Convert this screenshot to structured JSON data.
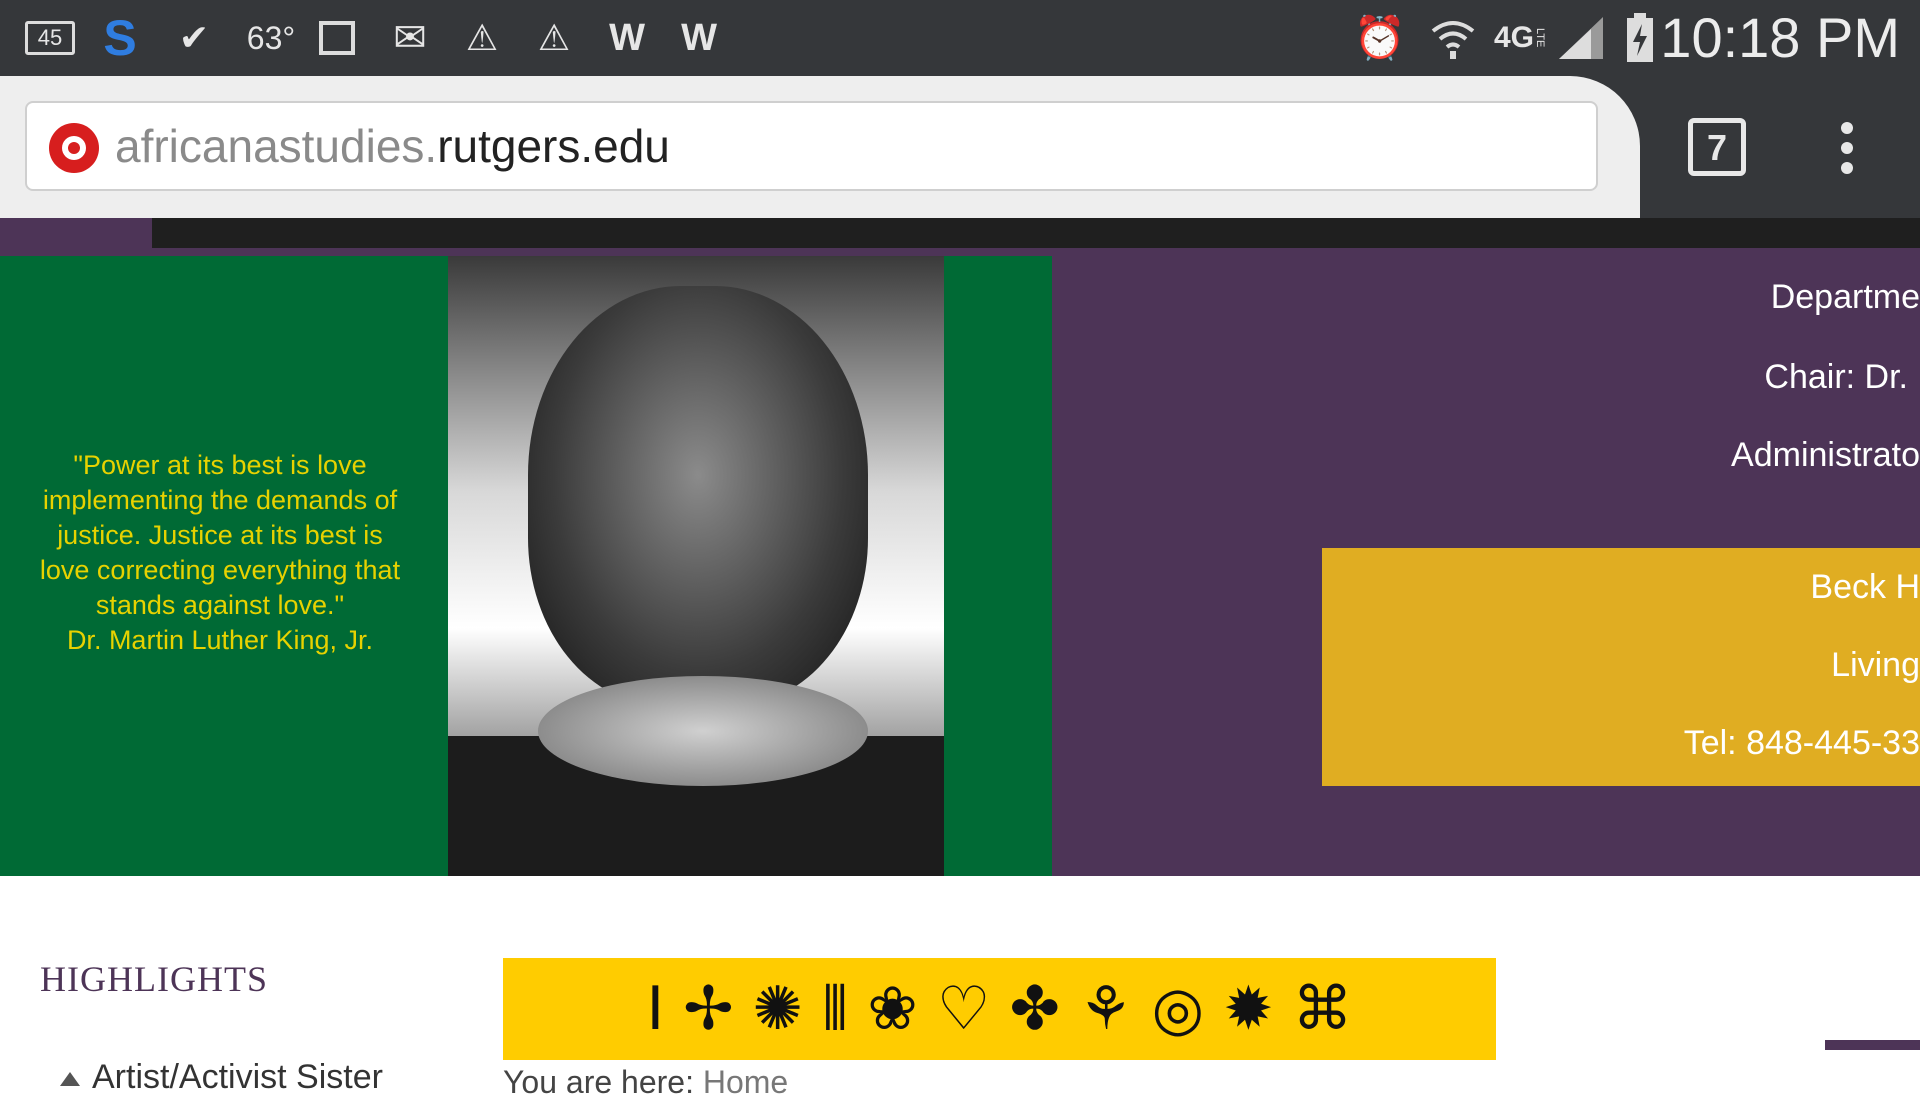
{
  "status_bar": {
    "battery_level": "45",
    "temperature": "63°",
    "network": "4G",
    "network_sub": "LTE",
    "time": "10:18 PM"
  },
  "browser": {
    "url_dim": "africanastudies.",
    "url_main": "rutgers.edu",
    "tab_count": "7"
  },
  "hero": {
    "quote_lines": [
      "\"Power at its best is love",
      "implementing the demands of",
      "justice. Justice at its best is",
      "love correcting everything that",
      "stands against love.\""
    ],
    "quote_author": "Dr. Martin Luther King, Jr.",
    "dept_title": "Departme",
    "chair": "Chair: Dr.",
    "administrator": "Administrato",
    "contact_building": "Beck H",
    "contact_living": "Living",
    "contact_tel": "Tel: 848-445-33"
  },
  "content": {
    "highlights_heading": "HIGHLIGHTS",
    "highlight_first": "Artist/Activist Sister",
    "adinkra_symbols": "Ⅰ ✢ ✺ ⦀ ❀ ♡ ✤ ⚘ ◎ ✹ ⌘",
    "breadcrumb_prefix": "You are here: ",
    "breadcrumb_home": "Home"
  },
  "colors": {
    "purple": "#4d3457",
    "green": "#006a35",
    "gold": "#e0ad22",
    "quote_yellow": "#e7d200",
    "adinkra_yellow": "#ffcc00"
  }
}
